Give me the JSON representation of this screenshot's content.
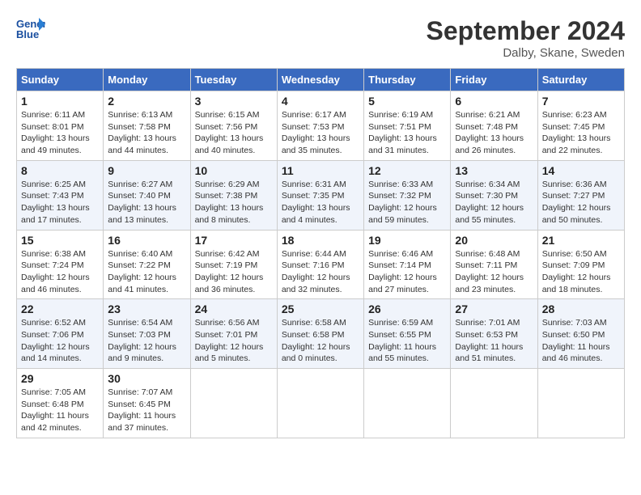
{
  "header": {
    "logo_line1": "General",
    "logo_line2": "Blue",
    "month": "September 2024",
    "location": "Dalby, Skane, Sweden"
  },
  "weekdays": [
    "Sunday",
    "Monday",
    "Tuesday",
    "Wednesday",
    "Thursday",
    "Friday",
    "Saturday"
  ],
  "weeks": [
    [
      {
        "day": "1",
        "info": "Sunrise: 6:11 AM\nSunset: 8:01 PM\nDaylight: 13 hours\nand 49 minutes."
      },
      {
        "day": "2",
        "info": "Sunrise: 6:13 AM\nSunset: 7:58 PM\nDaylight: 13 hours\nand 44 minutes."
      },
      {
        "day": "3",
        "info": "Sunrise: 6:15 AM\nSunset: 7:56 PM\nDaylight: 13 hours\nand 40 minutes."
      },
      {
        "day": "4",
        "info": "Sunrise: 6:17 AM\nSunset: 7:53 PM\nDaylight: 13 hours\nand 35 minutes."
      },
      {
        "day": "5",
        "info": "Sunrise: 6:19 AM\nSunset: 7:51 PM\nDaylight: 13 hours\nand 31 minutes."
      },
      {
        "day": "6",
        "info": "Sunrise: 6:21 AM\nSunset: 7:48 PM\nDaylight: 13 hours\nand 26 minutes."
      },
      {
        "day": "7",
        "info": "Sunrise: 6:23 AM\nSunset: 7:45 PM\nDaylight: 13 hours\nand 22 minutes."
      }
    ],
    [
      {
        "day": "8",
        "info": "Sunrise: 6:25 AM\nSunset: 7:43 PM\nDaylight: 13 hours\nand 17 minutes."
      },
      {
        "day": "9",
        "info": "Sunrise: 6:27 AM\nSunset: 7:40 PM\nDaylight: 13 hours\nand 13 minutes."
      },
      {
        "day": "10",
        "info": "Sunrise: 6:29 AM\nSunset: 7:38 PM\nDaylight: 13 hours\nand 8 minutes."
      },
      {
        "day": "11",
        "info": "Sunrise: 6:31 AM\nSunset: 7:35 PM\nDaylight: 13 hours\nand 4 minutes."
      },
      {
        "day": "12",
        "info": "Sunrise: 6:33 AM\nSunset: 7:32 PM\nDaylight: 12 hours\nand 59 minutes."
      },
      {
        "day": "13",
        "info": "Sunrise: 6:34 AM\nSunset: 7:30 PM\nDaylight: 12 hours\nand 55 minutes."
      },
      {
        "day": "14",
        "info": "Sunrise: 6:36 AM\nSunset: 7:27 PM\nDaylight: 12 hours\nand 50 minutes."
      }
    ],
    [
      {
        "day": "15",
        "info": "Sunrise: 6:38 AM\nSunset: 7:24 PM\nDaylight: 12 hours\nand 46 minutes."
      },
      {
        "day": "16",
        "info": "Sunrise: 6:40 AM\nSunset: 7:22 PM\nDaylight: 12 hours\nand 41 minutes."
      },
      {
        "day": "17",
        "info": "Sunrise: 6:42 AM\nSunset: 7:19 PM\nDaylight: 12 hours\nand 36 minutes."
      },
      {
        "day": "18",
        "info": "Sunrise: 6:44 AM\nSunset: 7:16 PM\nDaylight: 12 hours\nand 32 minutes."
      },
      {
        "day": "19",
        "info": "Sunrise: 6:46 AM\nSunset: 7:14 PM\nDaylight: 12 hours\nand 27 minutes."
      },
      {
        "day": "20",
        "info": "Sunrise: 6:48 AM\nSunset: 7:11 PM\nDaylight: 12 hours\nand 23 minutes."
      },
      {
        "day": "21",
        "info": "Sunrise: 6:50 AM\nSunset: 7:09 PM\nDaylight: 12 hours\nand 18 minutes."
      }
    ],
    [
      {
        "day": "22",
        "info": "Sunrise: 6:52 AM\nSunset: 7:06 PM\nDaylight: 12 hours\nand 14 minutes."
      },
      {
        "day": "23",
        "info": "Sunrise: 6:54 AM\nSunset: 7:03 PM\nDaylight: 12 hours\nand 9 minutes."
      },
      {
        "day": "24",
        "info": "Sunrise: 6:56 AM\nSunset: 7:01 PM\nDaylight: 12 hours\nand 5 minutes."
      },
      {
        "day": "25",
        "info": "Sunrise: 6:58 AM\nSunset: 6:58 PM\nDaylight: 12 hours\nand 0 minutes."
      },
      {
        "day": "26",
        "info": "Sunrise: 6:59 AM\nSunset: 6:55 PM\nDaylight: 11 hours\nand 55 minutes."
      },
      {
        "day": "27",
        "info": "Sunrise: 7:01 AM\nSunset: 6:53 PM\nDaylight: 11 hours\nand 51 minutes."
      },
      {
        "day": "28",
        "info": "Sunrise: 7:03 AM\nSunset: 6:50 PM\nDaylight: 11 hours\nand 46 minutes."
      }
    ],
    [
      {
        "day": "29",
        "info": "Sunrise: 7:05 AM\nSunset: 6:48 PM\nDaylight: 11 hours\nand 42 minutes."
      },
      {
        "day": "30",
        "info": "Sunrise: 7:07 AM\nSunset: 6:45 PM\nDaylight: 11 hours\nand 37 minutes."
      },
      null,
      null,
      null,
      null,
      null
    ]
  ]
}
